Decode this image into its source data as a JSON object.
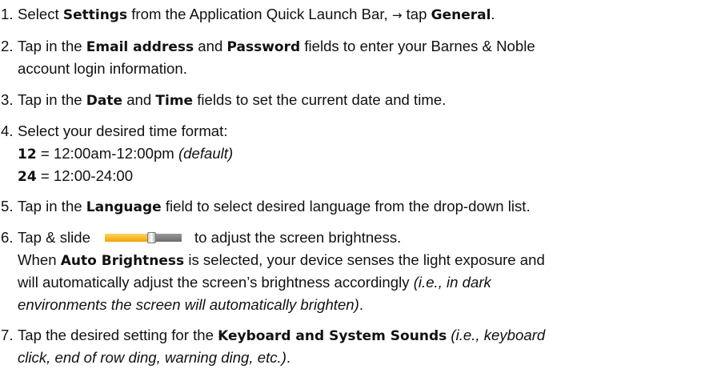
{
  "steps": [
    {
      "n": "1.",
      "a": "Select ",
      "b1": "Settings",
      "c": " from the Application Quick Launch Bar, ",
      "arrow": "→",
      "d": " tap ",
      "b2": "General",
      "e": "."
    },
    {
      "n": "2.",
      "a": "Tap in the ",
      "b1": "Email address",
      "c": " and ",
      "b2": "Password",
      "d": " fields to enter your Barnes & Noble",
      "line2": "account login information."
    },
    {
      "n": "3.",
      "a": "Tap in the ",
      "b1": "Date",
      "c": " and ",
      "b2": "Time",
      "d": " fields to set the current date and time."
    },
    {
      "n": "4.",
      "a": "Select your desired time format:",
      "opt1_key": "12",
      "opt1_val": " = 12:00am-12:00pm ",
      "opt1_note": "(default)",
      "opt2_key": "24",
      "opt2_val": " = 12:00-24:00"
    },
    {
      "n": "5.",
      "a": "Tap in the ",
      "b1": "Language",
      "c": " field to select desired language from the drop-down list."
    },
    {
      "n": "6.",
      "a": "Tap & slide",
      "c": "to adjust the screen brightness.",
      "slider_level": 0.6,
      "l2a": "When ",
      "l2b": "Auto Brightness",
      "l2c": " is selected, your device senses the light exposure and",
      "l3a": "will automatically adjust the screen’s brightness accordingly ",
      "l3b": "(i.e., in dark",
      "l4a": "environments the screen will automatically brighten)",
      "l4b": "."
    },
    {
      "n": "7.",
      "a": "Tap the desired setting for the ",
      "b1": "Keyboard and System Sounds",
      "c": " ",
      "note1": "(i.e., keyboard",
      "note2": "click, end of row ding, warning ding, etc.)",
      "end": "."
    }
  ]
}
